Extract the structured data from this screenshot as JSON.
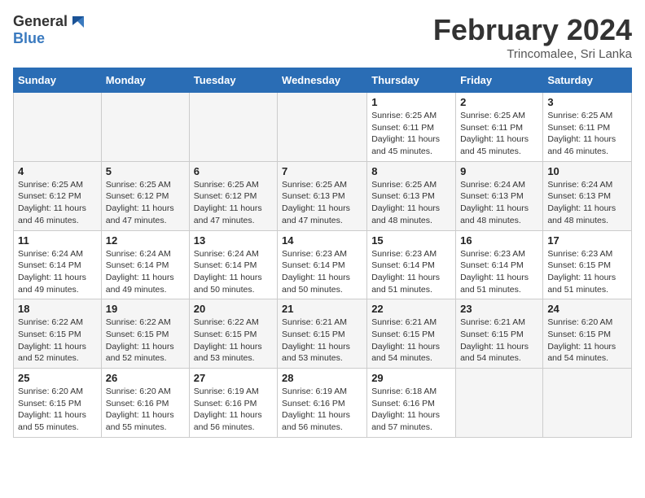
{
  "header": {
    "logo_general": "General",
    "logo_blue": "Blue",
    "month_year": "February 2024",
    "location": "Trincomalee, Sri Lanka"
  },
  "days_of_week": [
    "Sunday",
    "Monday",
    "Tuesday",
    "Wednesday",
    "Thursday",
    "Friday",
    "Saturday"
  ],
  "weeks": [
    [
      {
        "day": "",
        "info": ""
      },
      {
        "day": "",
        "info": ""
      },
      {
        "day": "",
        "info": ""
      },
      {
        "day": "",
        "info": ""
      },
      {
        "day": "1",
        "info": "Sunrise: 6:25 AM\nSunset: 6:11 PM\nDaylight: 11 hours\nand 45 minutes."
      },
      {
        "day": "2",
        "info": "Sunrise: 6:25 AM\nSunset: 6:11 PM\nDaylight: 11 hours\nand 45 minutes."
      },
      {
        "day": "3",
        "info": "Sunrise: 6:25 AM\nSunset: 6:11 PM\nDaylight: 11 hours\nand 46 minutes."
      }
    ],
    [
      {
        "day": "4",
        "info": "Sunrise: 6:25 AM\nSunset: 6:12 PM\nDaylight: 11 hours\nand 46 minutes."
      },
      {
        "day": "5",
        "info": "Sunrise: 6:25 AM\nSunset: 6:12 PM\nDaylight: 11 hours\nand 47 minutes."
      },
      {
        "day": "6",
        "info": "Sunrise: 6:25 AM\nSunset: 6:12 PM\nDaylight: 11 hours\nand 47 minutes."
      },
      {
        "day": "7",
        "info": "Sunrise: 6:25 AM\nSunset: 6:13 PM\nDaylight: 11 hours\nand 47 minutes."
      },
      {
        "day": "8",
        "info": "Sunrise: 6:25 AM\nSunset: 6:13 PM\nDaylight: 11 hours\nand 48 minutes."
      },
      {
        "day": "9",
        "info": "Sunrise: 6:24 AM\nSunset: 6:13 PM\nDaylight: 11 hours\nand 48 minutes."
      },
      {
        "day": "10",
        "info": "Sunrise: 6:24 AM\nSunset: 6:13 PM\nDaylight: 11 hours\nand 48 minutes."
      }
    ],
    [
      {
        "day": "11",
        "info": "Sunrise: 6:24 AM\nSunset: 6:14 PM\nDaylight: 11 hours\nand 49 minutes."
      },
      {
        "day": "12",
        "info": "Sunrise: 6:24 AM\nSunset: 6:14 PM\nDaylight: 11 hours\nand 49 minutes."
      },
      {
        "day": "13",
        "info": "Sunrise: 6:24 AM\nSunset: 6:14 PM\nDaylight: 11 hours\nand 50 minutes."
      },
      {
        "day": "14",
        "info": "Sunrise: 6:23 AM\nSunset: 6:14 PM\nDaylight: 11 hours\nand 50 minutes."
      },
      {
        "day": "15",
        "info": "Sunrise: 6:23 AM\nSunset: 6:14 PM\nDaylight: 11 hours\nand 51 minutes."
      },
      {
        "day": "16",
        "info": "Sunrise: 6:23 AM\nSunset: 6:14 PM\nDaylight: 11 hours\nand 51 minutes."
      },
      {
        "day": "17",
        "info": "Sunrise: 6:23 AM\nSunset: 6:15 PM\nDaylight: 11 hours\nand 51 minutes."
      }
    ],
    [
      {
        "day": "18",
        "info": "Sunrise: 6:22 AM\nSunset: 6:15 PM\nDaylight: 11 hours\nand 52 minutes."
      },
      {
        "day": "19",
        "info": "Sunrise: 6:22 AM\nSunset: 6:15 PM\nDaylight: 11 hours\nand 52 minutes."
      },
      {
        "day": "20",
        "info": "Sunrise: 6:22 AM\nSunset: 6:15 PM\nDaylight: 11 hours\nand 53 minutes."
      },
      {
        "day": "21",
        "info": "Sunrise: 6:21 AM\nSunset: 6:15 PM\nDaylight: 11 hours\nand 53 minutes."
      },
      {
        "day": "22",
        "info": "Sunrise: 6:21 AM\nSunset: 6:15 PM\nDaylight: 11 hours\nand 54 minutes."
      },
      {
        "day": "23",
        "info": "Sunrise: 6:21 AM\nSunset: 6:15 PM\nDaylight: 11 hours\nand 54 minutes."
      },
      {
        "day": "24",
        "info": "Sunrise: 6:20 AM\nSunset: 6:15 PM\nDaylight: 11 hours\nand 54 minutes."
      }
    ],
    [
      {
        "day": "25",
        "info": "Sunrise: 6:20 AM\nSunset: 6:15 PM\nDaylight: 11 hours\nand 55 minutes."
      },
      {
        "day": "26",
        "info": "Sunrise: 6:20 AM\nSunset: 6:16 PM\nDaylight: 11 hours\nand 55 minutes."
      },
      {
        "day": "27",
        "info": "Sunrise: 6:19 AM\nSunset: 6:16 PM\nDaylight: 11 hours\nand 56 minutes."
      },
      {
        "day": "28",
        "info": "Sunrise: 6:19 AM\nSunset: 6:16 PM\nDaylight: 11 hours\nand 56 minutes."
      },
      {
        "day": "29",
        "info": "Sunrise: 6:18 AM\nSunset: 6:16 PM\nDaylight: 11 hours\nand 57 minutes."
      },
      {
        "day": "",
        "info": ""
      },
      {
        "day": "",
        "info": ""
      }
    ]
  ]
}
